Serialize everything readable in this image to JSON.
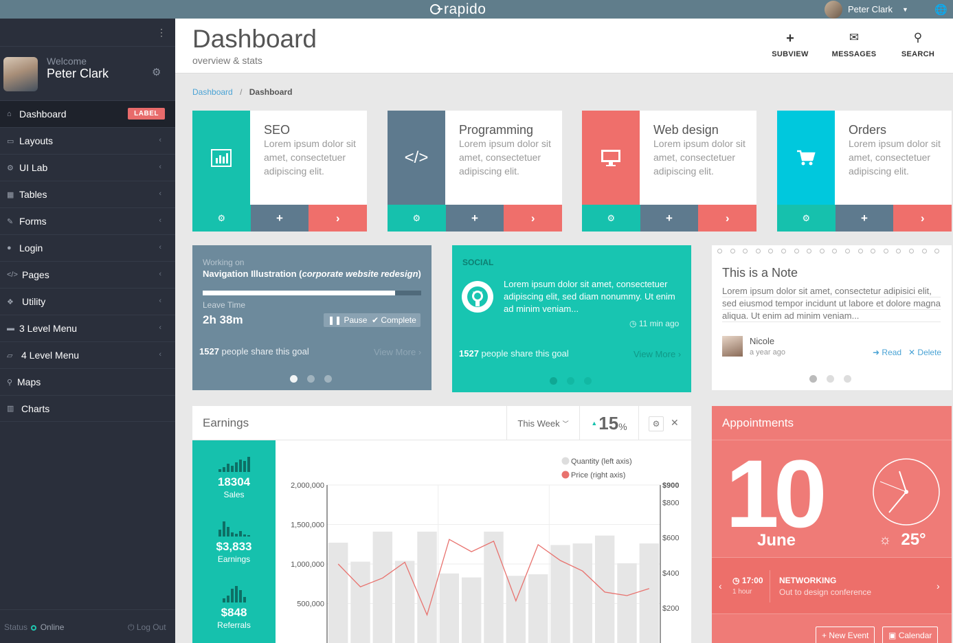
{
  "topbar": {
    "logo": "rapido",
    "user": "Peter Clark"
  },
  "sidebar": {
    "welcome": "Welcome",
    "name": "Peter Clark",
    "badge": "LABEL",
    "items": [
      {
        "label": "Dashboard",
        "icon": "home-icon"
      },
      {
        "label": "Layouts",
        "icon": "desktop-icon"
      },
      {
        "label": "UI Lab",
        "icon": "cogs-icon"
      },
      {
        "label": "Tables",
        "icon": "th-icon"
      },
      {
        "label": "Forms",
        "icon": "pencil-icon"
      },
      {
        "label": "Login",
        "icon": "user-icon"
      },
      {
        "label": "Pages",
        "icon": "code-icon"
      },
      {
        "label": "Utility",
        "icon": "cubes-icon"
      },
      {
        "label": "3 Level Menu",
        "icon": "folder-icon"
      },
      {
        "label": "4 Level Menu",
        "icon": "folder-open-icon"
      },
      {
        "label": "Maps",
        "icon": "map-marker-icon"
      },
      {
        "label": "Charts",
        "icon": "bar-chart-icon"
      }
    ],
    "status_label": "Status",
    "status_value": "Online",
    "logout": "Log Out"
  },
  "header": {
    "title": "Dashboard",
    "subtitle": "overview & stats",
    "buttons": [
      "SUBVIEW",
      "MESSAGES",
      "SEARCH"
    ]
  },
  "breadcrumb": {
    "link": "Dashboard",
    "current": "Dashboard"
  },
  "cards": [
    {
      "title": "SEO",
      "text": "Lorem ipsum dolor sit amet, consectetuer adipiscing elit.",
      "color": "#16c1ad"
    },
    {
      "title": "Programming",
      "text": "Lorem ipsum dolor sit amet, consectetuer adipiscing elit.",
      "color": "#5e7a8e"
    },
    {
      "title": "Web design",
      "text": "Lorem ipsum dolor sit amet, consectetuer adipiscing elit.",
      "color": "#ef6f6b"
    },
    {
      "title": "Orders",
      "text": "Lorem ipsum dolor sit amet, consectetuer adipiscing elit.",
      "color": "#00c8dd"
    }
  ],
  "work": {
    "label": "Working on",
    "project": "Navigation Illustration",
    "project_note": "corporate website redesign",
    "progress": 0.88,
    "leave_label": "Leave Time",
    "leave_time": "2h 38m",
    "pause": "Pause",
    "complete": "Complete",
    "share_count": "1527",
    "share_text": "people share this goal",
    "more": "View More"
  },
  "social": {
    "label": "SOCIAL",
    "text": "Lorem ipsum dolor sit amet, consectetuer adipiscing elit, sed diam nonummy. Ut enim ad minim veniam...",
    "time": "11 min ago",
    "share_count": "1527",
    "share_text": "people share this goal",
    "more": "View More"
  },
  "note": {
    "title": "This is a Note",
    "body": "Lorem ipsum dolor sit amet, consectetur adipisici elit, sed eiusmod tempor incidunt ut labore et dolore magna aliqua. Ut enim ad minim veniam...",
    "author": "Nicole",
    "ago": "a year ago",
    "read": "Read",
    "delete": "Delete"
  },
  "earnings": {
    "title": "Earnings",
    "period": "This Week",
    "percent": "15",
    "percent_sign": "%",
    "stats": [
      {
        "value": "18304",
        "label": "Sales"
      },
      {
        "value": "$3,833",
        "label": "Earnings"
      },
      {
        "value": "$848",
        "label": "Referrals"
      }
    ]
  },
  "chart_data": {
    "type": "bar",
    "series": [
      {
        "name": "Quantity (left axis)",
        "type": "bar",
        "axis": "left",
        "values": [
          1270000,
          1030000,
          1410000,
          1040000,
          1410000,
          880000,
          830000,
          1410000,
          850000,
          870000,
          1240000,
          1260000,
          1360000,
          1010000,
          1260000
        ]
      },
      {
        "name": "Price (right axis)",
        "type": "line",
        "axis": "right",
        "values": [
          450,
          320,
          370,
          460,
          160,
          590,
          520,
          580,
          240,
          560,
          470,
          410,
          290,
          270,
          310
        ]
      }
    ],
    "y_left_ticks": [
      "2,000,000",
      "1,500,000",
      "1,000,000",
      "500,000"
    ],
    "y_right_ticks": [
      "$900",
      "$800",
      "$600",
      "$400",
      "$200"
    ],
    "ylim_left": [
      0,
      2000000
    ],
    "ylim_right": [
      0,
      900
    ],
    "grid": true,
    "legend": "top-right",
    "colors": {
      "bar": "#e6e6e6",
      "line": "#e8726e",
      "legend_quantity": "#dddddd",
      "legend_price": "#e8726e"
    }
  },
  "appointments": {
    "title": "Appointments",
    "day": "10",
    "month": "June",
    "temp": "25°",
    "event_time": "17:00",
    "event_duration": "1 hour",
    "event_name": "NETWORKING",
    "event_desc": "Out to design conference",
    "new_event": "New Event",
    "calendar": "Calendar"
  }
}
